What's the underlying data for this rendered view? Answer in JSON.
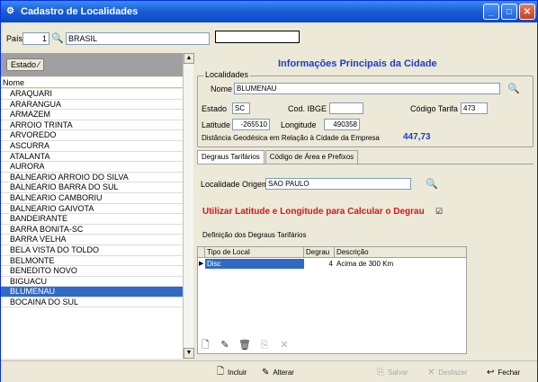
{
  "window": {
    "title": "Cadastro de Localidades"
  },
  "pais": {
    "label": "País",
    "code": "1",
    "name": "BRASIL"
  },
  "left": {
    "sort_tag": "Estado",
    "column_header": "Nome",
    "items": [
      "ARAQUARI",
      "ARARANGUA",
      "ARMAZEM",
      "ARROIO TRINTA",
      "ARVOREDO",
      "ASCURRA",
      "ATALANTA",
      "AURORA",
      "BALNEARIO ARROIO DO SILVA",
      "BALNEARIO BARRA DO SUL",
      "BALNEARIO CAMBORIU",
      "BALNEARIO GAIVOTA",
      "BANDEIRANTE",
      "BARRA BONITA-SC",
      "BARRA VELHA",
      "BELA VISTA DO TOLDO",
      "BELMONTE",
      "BENEDITO NOVO",
      "BIGUACU",
      "BLUMENAU",
      "BOCAINA DO SUL"
    ],
    "selected_index": 19
  },
  "main": {
    "heading": "Informações Principais da Cidade",
    "group_label": "Localidades",
    "nome_label": "Nome",
    "nome_value": "BLUMENAU",
    "estado_label": "Estado",
    "estado_value": "SC",
    "ibge_label": "Cod. IBGE",
    "ibge_value": "",
    "tarifa_label": "Código Tarifa",
    "tarifa_value": "473",
    "lat_label": "Latitude",
    "lat_value": "-265510",
    "lon_label": "Longitude",
    "lon_value": "490358",
    "dist_label": "Distância Geodésica em Relação à Cidade da Empresa",
    "dist_value": "447,73"
  },
  "tabs": [
    {
      "label": "Degraus Tarifários"
    },
    {
      "label": "Código de Área e Prefixos"
    }
  ],
  "degraus": {
    "origem_label": "Localidade Origem",
    "origem_value": "SAO PAULO",
    "use_latlon_label": "Utilizar Latitude e Longitude para Calcular o Degrau",
    "use_latlon_checked": "☑",
    "section_label": "Definição dos Degraus Tarifários",
    "columns": [
      "Tipo de Local",
      "Degrau",
      "Descrição"
    ],
    "row": {
      "marker": "▶",
      "tipo": "Disc",
      "degrau": "4",
      "descricao": "Acima de 300 Km"
    }
  },
  "footer": {
    "incluir": "Incluir",
    "alterar": "Alterar",
    "salvar": "Salvar",
    "desfazer": "Desfazer",
    "fechar": "Fechar"
  }
}
